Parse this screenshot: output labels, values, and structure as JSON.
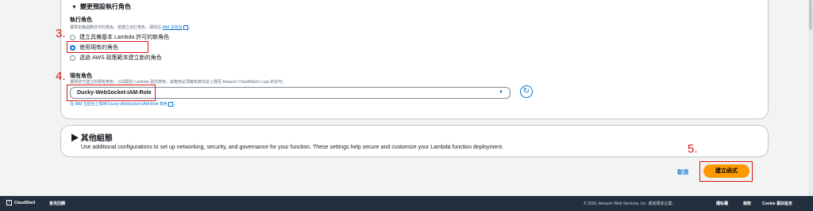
{
  "section": {
    "toggle_label": "變更預設執行角色",
    "caret": "▼"
  },
  "exec_role": {
    "label": "執行角色",
    "description_prefix": "選擇定義函數許可的角色。若建立自訂角色，請前往",
    "iam_console_link": "IAM 主控台",
    "description_suffix": "。",
    "options": [
      {
        "label": "建立具備基本 Lambda 許可的新角色",
        "selected": false
      },
      {
        "label": "使用現有的角色",
        "selected": true
      },
      {
        "label": "透過 AWS 政策範本建立新的角色",
        "selected": false
      }
    ]
  },
  "existing_role": {
    "label": "現有角色",
    "description": "選擇您已建立的現有角色，以與配此 Lambda 函式使用。該角色必須擁有將日誌上傳至 Amazon CloudWatch Logs 的許可。",
    "selected_value": "Ducky-WebSocket-IAM-Role",
    "view_link": "在 IAM 主控台上檢視 Ducky-WebSocket-IAM-Role 角色",
    "view_link_suffix": "。"
  },
  "other_settings": {
    "caret": "▶",
    "title": "其他組態",
    "description": "Use additional configurations to set up networking, security, and governance for your function. These settings help secure and customize your Lambda function deployment."
  },
  "actions": {
    "cancel_label": "取消",
    "create_label": "建立函式"
  },
  "annotations": {
    "n3": "3.",
    "n4": "4.",
    "n5": "5."
  },
  "footer": {
    "cloudshell": "CloudShell",
    "feedback": "意見回饋",
    "copyright": "© 2025, Amazon Web Services, Inc. 或其關係企業。",
    "privacy": "隱私權",
    "terms": "條款",
    "cookie": "Cookie 喜好設定"
  },
  "colors": {
    "accent": "#0972d3",
    "primary_button": "#ff9900",
    "annotation": "#d91515",
    "footer_bg": "#232f3e"
  },
  "icons": {
    "refresh": "refresh-icon",
    "external": "external-link-icon",
    "cloudshell": "cloudshell-icon",
    "dropdown": "caret-down-icon"
  }
}
